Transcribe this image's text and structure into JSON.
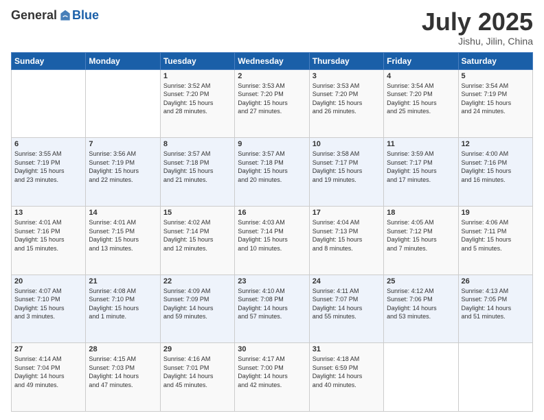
{
  "logo": {
    "general": "General",
    "blue": "Blue"
  },
  "header": {
    "month": "July 2025",
    "location": "Jishu, Jilin, China"
  },
  "days_of_week": [
    "Sunday",
    "Monday",
    "Tuesday",
    "Wednesday",
    "Thursday",
    "Friday",
    "Saturday"
  ],
  "weeks": [
    [
      {
        "day": "",
        "info": ""
      },
      {
        "day": "",
        "info": ""
      },
      {
        "day": "1",
        "info": "Sunrise: 3:52 AM\nSunset: 7:20 PM\nDaylight: 15 hours\nand 28 minutes."
      },
      {
        "day": "2",
        "info": "Sunrise: 3:53 AM\nSunset: 7:20 PM\nDaylight: 15 hours\nand 27 minutes."
      },
      {
        "day": "3",
        "info": "Sunrise: 3:53 AM\nSunset: 7:20 PM\nDaylight: 15 hours\nand 26 minutes."
      },
      {
        "day": "4",
        "info": "Sunrise: 3:54 AM\nSunset: 7:20 PM\nDaylight: 15 hours\nand 25 minutes."
      },
      {
        "day": "5",
        "info": "Sunrise: 3:54 AM\nSunset: 7:19 PM\nDaylight: 15 hours\nand 24 minutes."
      }
    ],
    [
      {
        "day": "6",
        "info": "Sunrise: 3:55 AM\nSunset: 7:19 PM\nDaylight: 15 hours\nand 23 minutes."
      },
      {
        "day": "7",
        "info": "Sunrise: 3:56 AM\nSunset: 7:19 PM\nDaylight: 15 hours\nand 22 minutes."
      },
      {
        "day": "8",
        "info": "Sunrise: 3:57 AM\nSunset: 7:18 PM\nDaylight: 15 hours\nand 21 minutes."
      },
      {
        "day": "9",
        "info": "Sunrise: 3:57 AM\nSunset: 7:18 PM\nDaylight: 15 hours\nand 20 minutes."
      },
      {
        "day": "10",
        "info": "Sunrise: 3:58 AM\nSunset: 7:17 PM\nDaylight: 15 hours\nand 19 minutes."
      },
      {
        "day": "11",
        "info": "Sunrise: 3:59 AM\nSunset: 7:17 PM\nDaylight: 15 hours\nand 17 minutes."
      },
      {
        "day": "12",
        "info": "Sunrise: 4:00 AM\nSunset: 7:16 PM\nDaylight: 15 hours\nand 16 minutes."
      }
    ],
    [
      {
        "day": "13",
        "info": "Sunrise: 4:01 AM\nSunset: 7:16 PM\nDaylight: 15 hours\nand 15 minutes."
      },
      {
        "day": "14",
        "info": "Sunrise: 4:01 AM\nSunset: 7:15 PM\nDaylight: 15 hours\nand 13 minutes."
      },
      {
        "day": "15",
        "info": "Sunrise: 4:02 AM\nSunset: 7:14 PM\nDaylight: 15 hours\nand 12 minutes."
      },
      {
        "day": "16",
        "info": "Sunrise: 4:03 AM\nSunset: 7:14 PM\nDaylight: 15 hours\nand 10 minutes."
      },
      {
        "day": "17",
        "info": "Sunrise: 4:04 AM\nSunset: 7:13 PM\nDaylight: 15 hours\nand 8 minutes."
      },
      {
        "day": "18",
        "info": "Sunrise: 4:05 AM\nSunset: 7:12 PM\nDaylight: 15 hours\nand 7 minutes."
      },
      {
        "day": "19",
        "info": "Sunrise: 4:06 AM\nSunset: 7:11 PM\nDaylight: 15 hours\nand 5 minutes."
      }
    ],
    [
      {
        "day": "20",
        "info": "Sunrise: 4:07 AM\nSunset: 7:10 PM\nDaylight: 15 hours\nand 3 minutes."
      },
      {
        "day": "21",
        "info": "Sunrise: 4:08 AM\nSunset: 7:10 PM\nDaylight: 15 hours\nand 1 minute."
      },
      {
        "day": "22",
        "info": "Sunrise: 4:09 AM\nSunset: 7:09 PM\nDaylight: 14 hours\nand 59 minutes."
      },
      {
        "day": "23",
        "info": "Sunrise: 4:10 AM\nSunset: 7:08 PM\nDaylight: 14 hours\nand 57 minutes."
      },
      {
        "day": "24",
        "info": "Sunrise: 4:11 AM\nSunset: 7:07 PM\nDaylight: 14 hours\nand 55 minutes."
      },
      {
        "day": "25",
        "info": "Sunrise: 4:12 AM\nSunset: 7:06 PM\nDaylight: 14 hours\nand 53 minutes."
      },
      {
        "day": "26",
        "info": "Sunrise: 4:13 AM\nSunset: 7:05 PM\nDaylight: 14 hours\nand 51 minutes."
      }
    ],
    [
      {
        "day": "27",
        "info": "Sunrise: 4:14 AM\nSunset: 7:04 PM\nDaylight: 14 hours\nand 49 minutes."
      },
      {
        "day": "28",
        "info": "Sunrise: 4:15 AM\nSunset: 7:03 PM\nDaylight: 14 hours\nand 47 minutes."
      },
      {
        "day": "29",
        "info": "Sunrise: 4:16 AM\nSunset: 7:01 PM\nDaylight: 14 hours\nand 45 minutes."
      },
      {
        "day": "30",
        "info": "Sunrise: 4:17 AM\nSunset: 7:00 PM\nDaylight: 14 hours\nand 42 minutes."
      },
      {
        "day": "31",
        "info": "Sunrise: 4:18 AM\nSunset: 6:59 PM\nDaylight: 14 hours\nand 40 minutes."
      },
      {
        "day": "",
        "info": ""
      },
      {
        "day": "",
        "info": ""
      }
    ]
  ]
}
